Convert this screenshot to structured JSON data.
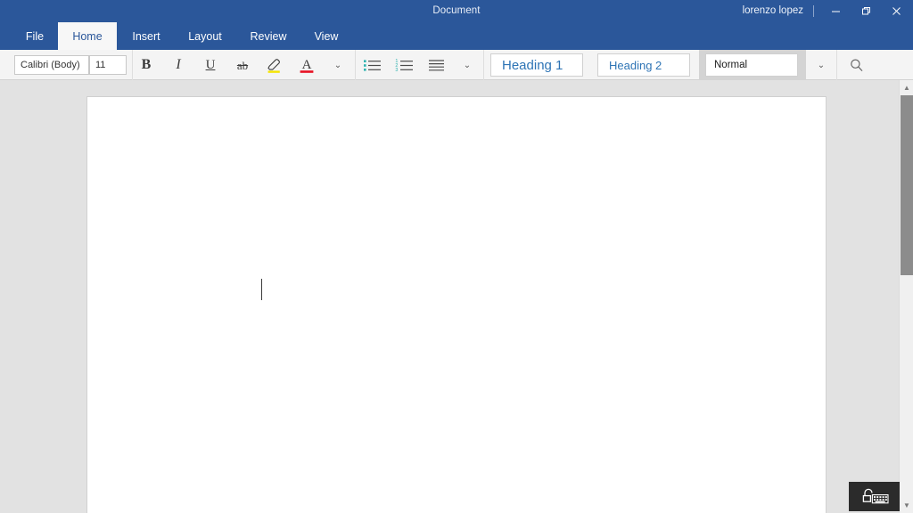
{
  "window": {
    "title": "Document",
    "user": "lorenzo lopez",
    "controls": {
      "minimize": "minimize-button",
      "restore": "restore-button",
      "close": "close-button"
    }
  },
  "tabs": [
    {
      "label": "File",
      "active": false
    },
    {
      "label": "Home",
      "active": true
    },
    {
      "label": "Insert",
      "active": false
    },
    {
      "label": "Layout",
      "active": false
    },
    {
      "label": "Review",
      "active": false
    },
    {
      "label": "View",
      "active": false
    }
  ],
  "title_icons": [
    {
      "name": "lightbulb-icon"
    },
    {
      "name": "read-mode-icon"
    },
    {
      "name": "share-person-icon"
    },
    {
      "name": "undo-icon"
    },
    {
      "name": "redo-icon"
    }
  ],
  "ribbon": {
    "font": {
      "name_value": "Calibri (Body)",
      "size_value": "11",
      "bold_label": "B",
      "italic_label": "I",
      "underline_label": "U",
      "strikethrough_label": "ab",
      "highlight_color": "#f5e400",
      "fontcolor_label": "A",
      "fontcolor_color": "#e81123",
      "expand_label": "⌄"
    },
    "paragraph": {
      "bullets_label": "bulleted-list",
      "numbering_label": "numbered-list",
      "align_label": "align-text",
      "expand_label": "⌄",
      "marker_color": "#2fb3b0"
    },
    "styles": [
      {
        "label": "Heading 1",
        "selected": false
      },
      {
        "label": "Heading 2",
        "selected": false
      },
      {
        "label": "Normal",
        "selected": true
      }
    ],
    "styles_expand_label": "⌄",
    "search_label": "search-icon"
  },
  "document": {
    "page_label": "document-page",
    "caret_visible": true
  },
  "scrollbar": {
    "up_label": "▲",
    "down_label": "▼"
  },
  "taskbar": {
    "keyboard_label": "touch-keyboard-button"
  },
  "colors": {
    "brand_blue": "#2b579a",
    "ribbon_bg": "#f4f4f4",
    "workspace_bg": "#e2e2e2",
    "style_blue": "#2e74b5"
  }
}
